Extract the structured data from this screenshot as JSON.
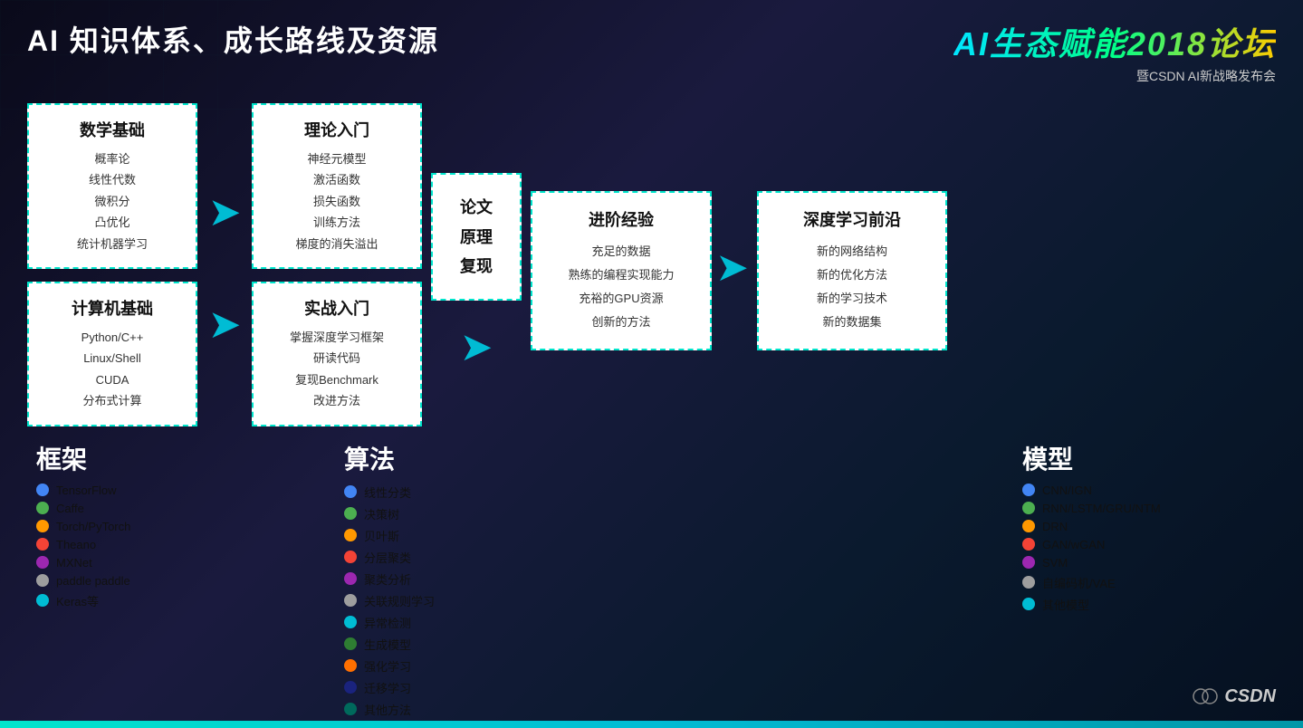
{
  "page": {
    "title": "AI 知识体系、成长路线及资源",
    "logo_main": "AI生态赋能2018论坛",
    "logo_sub": "暨CSDN AI新战略发布会"
  },
  "math_basics": {
    "title": "数学基础",
    "items": [
      "概率论",
      "线性代数",
      "微积分",
      "凸优化",
      "统计机器学习"
    ]
  },
  "cs_basics": {
    "title": "计算机基础",
    "items": [
      "Python/C++",
      "Linux/Shell",
      "CUDA",
      "分布式计算"
    ]
  },
  "theory_intro": {
    "title": "理论入门",
    "items": [
      "神经元模型",
      "激活函数",
      "损失函数",
      "训练方法",
      "梯度的消失溢出"
    ]
  },
  "practice_intro": {
    "title": "实战入门",
    "items": [
      "掌握深度学习框架",
      "研读代码",
      "复现Benchmark",
      "改进方法"
    ]
  },
  "paper_box": {
    "lines": [
      "论文",
      "原理",
      "复现"
    ]
  },
  "advanced": {
    "title": "进阶经验",
    "items": [
      "充足的数据",
      "熟练的编程实现能力",
      "充裕的GPU资源",
      "创新的方法"
    ]
  },
  "deep_learning": {
    "title": "深度学习前沿",
    "items": [
      "新的网络结构",
      "新的优化方法",
      "新的学习技术",
      "新的数据集"
    ]
  },
  "frameworks": {
    "label": "框架",
    "items": [
      {
        "name": "TensorFlow",
        "color": "#4285f4"
      },
      {
        "name": "Caffe",
        "color": "#4caf50"
      },
      {
        "name": "Torch/PyTorch",
        "color": "#ff9800"
      },
      {
        "name": "Theano",
        "color": "#f44336"
      },
      {
        "name": "MXNet",
        "color": "#9c27b0"
      },
      {
        "name": "paddle paddle",
        "color": "#9e9e9e"
      },
      {
        "name": "Keras等",
        "color": "#00bcd4"
      }
    ]
  },
  "algorithms": {
    "label": "算法",
    "items": [
      {
        "name": "线性分类",
        "color": "#4285f4"
      },
      {
        "name": "决策树",
        "color": "#4caf50"
      },
      {
        "name": "贝叶斯",
        "color": "#ff9800"
      },
      {
        "name": "分层聚类",
        "color": "#f44336"
      },
      {
        "name": "聚类分析",
        "color": "#9c27b0"
      },
      {
        "name": "关联规则学习",
        "color": "#9e9e9e"
      },
      {
        "name": "异常检测",
        "color": "#00bcd4"
      },
      {
        "name": "生成模型",
        "color": "#2e7d32"
      },
      {
        "name": "强化学习",
        "color": "#ff6f00"
      },
      {
        "name": "迁移学习",
        "color": "#1a237e"
      },
      {
        "name": "其他方法",
        "color": "#00695c"
      }
    ]
  },
  "models": {
    "label": "模型",
    "items": [
      {
        "name": "CNN/IGN",
        "color": "#4285f4"
      },
      {
        "name": "RNN/LSTM/GRU/NTM",
        "color": "#4caf50"
      },
      {
        "name": "DRN",
        "color": "#ff9800"
      },
      {
        "name": "GAN/wGAN",
        "color": "#f44336"
      },
      {
        "name": "SVM",
        "color": "#9c27b0"
      },
      {
        "name": "自编码机/VAE",
        "color": "#9e9e9e"
      },
      {
        "name": "其他模型",
        "color": "#00bcd4"
      }
    ]
  },
  "csdn": {
    "text": "CSDN"
  }
}
